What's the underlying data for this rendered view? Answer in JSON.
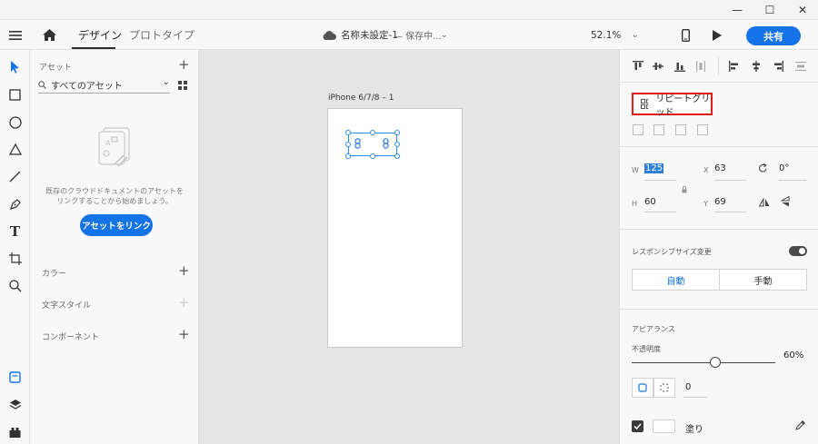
{
  "window": {
    "minimize": "—",
    "maximize": "☐",
    "close": "✕"
  },
  "toolbar": {
    "tabs": [
      {
        "label": "デザイン",
        "active": true
      },
      {
        "label": "プロトタイプ",
        "active": false
      }
    ],
    "document_title": "名称未設定-1",
    "document_status": "— 保存中...",
    "zoom": "52.1%",
    "share_label": "共有"
  },
  "assets": {
    "section_title": "アセット",
    "search_value": "すべてのアセット",
    "empty_message_line1": "既存のクラウドドキュメントのアセットを",
    "empty_message_line2": "リンクすることから始めましょう。",
    "link_button": "アセットをリンク",
    "sections": [
      {
        "label": "カラー"
      },
      {
        "label": "文字スタイル"
      },
      {
        "label": "コンポーネント"
      }
    ]
  },
  "canvas": {
    "artboard_name": "iPhone 6/7/8 – 1"
  },
  "properties": {
    "repeat_grid_label": "リピートグリッド",
    "w_label": "W",
    "w_value": "125",
    "h_label": "H",
    "h_value": "60",
    "x_label": "X",
    "x_value": "63",
    "y_label": "Y",
    "y_value": "69",
    "rotation_value": "0°",
    "responsive_label": "レスポンシブサイズ変更",
    "responsive_on": true,
    "seg_auto": "自動",
    "seg_manual": "手動",
    "appearance_label": "アピアランス",
    "opacity_label": "不透明度",
    "opacity_value": "60%",
    "opacity_fraction": 0.6,
    "corner_value": "0",
    "fill_label": "塗り",
    "fill_color": "#FFFFFF"
  },
  "colors": {
    "accent": "#1473E6",
    "highlight": "#E41B1B",
    "selection": "#2D8CEB"
  }
}
